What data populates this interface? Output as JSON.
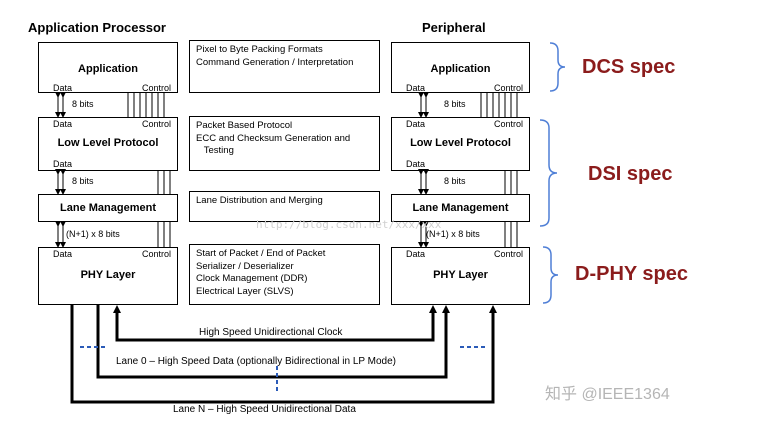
{
  "headers": {
    "left": "Application Processor",
    "right": "Peripheral"
  },
  "layers": [
    {
      "key": "application",
      "title": "Application"
    },
    {
      "key": "llp",
      "title": "Low Level Protocol"
    },
    {
      "key": "lane",
      "title": "Lane Management"
    },
    {
      "key": "phy",
      "title": "PHY Layer"
    }
  ],
  "ports": {
    "data": "Data",
    "control": "Control"
  },
  "bus_labels": {
    "bits8": "8 bits",
    "bits_n": "(N+1) x 8 bits"
  },
  "middle": {
    "application": [
      "Pixel to Byte Packing Formats",
      "",
      "Command Generation / Interpretation"
    ],
    "llp": [
      "Packet Based Protocol",
      "ECC and Checksum Generation and",
      "   Testing"
    ],
    "lane": [
      "Lane Distribution and Merging"
    ],
    "phy": [
      "Start of Packet / End of Packet",
      "Serializer / Deserializer",
      "Clock Management (DDR)",
      "Electrical Layer (SLVS)"
    ]
  },
  "specs": {
    "dcs": "DCS spec",
    "dsi": "DSI spec",
    "dphy": "D-PHY spec"
  },
  "lines": {
    "clock": "High Speed Unidirectional Clock",
    "lane0": "Lane 0 – High Speed Data (optionally Bidirectional in LP Mode)",
    "laneN": "Lane N – High Speed Unidirectional Data"
  },
  "watermark": {
    "logo": "知乎 @IEEE1364",
    "url": "http://blog.csdn.net/xxx/xxx"
  },
  "colors": {
    "spec_text": "#8b1c1c",
    "bracket": "#4f7fd6",
    "dashes": "#2b5bb8"
  }
}
